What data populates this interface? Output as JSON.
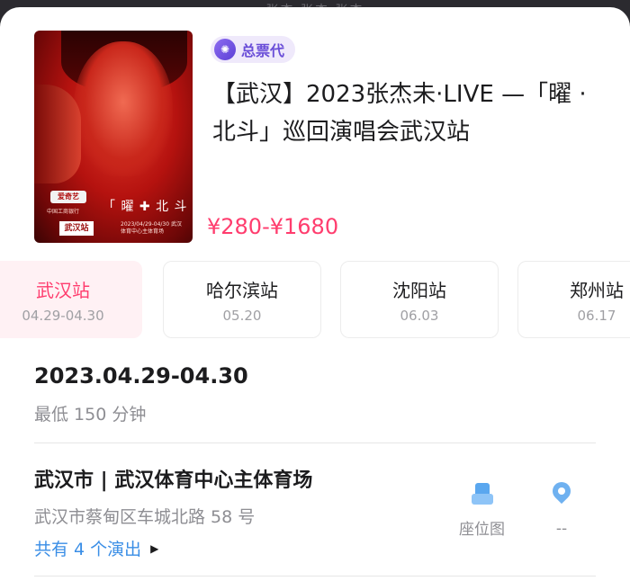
{
  "top_strip": {
    "text": "张杰 张杰 张杰"
  },
  "event": {
    "badge": "总票代",
    "title": "【武汉】2023张杰未·LIVE —「曜 · 北斗」巡回演唱会武汉站",
    "price": "¥280-¥1680",
    "poster": {
      "logo": "爱奇艺",
      "tagline": "中国工商银行",
      "title_text": "「 曜 ✚ 北 斗 」",
      "dates": "2023/04/29-04/30 武汉体育中心主体育场",
      "station_label": "武汉站"
    }
  },
  "stations": [
    {
      "name": "武汉站",
      "dates": "04.29-04.30",
      "active": true
    },
    {
      "name": "哈尔滨站",
      "dates": "05.20",
      "active": false
    },
    {
      "name": "沈阳站",
      "dates": "06.03",
      "active": false
    },
    {
      "name": "郑州站",
      "dates": "06.17",
      "active": false
    }
  ],
  "details": {
    "date_range": "2023.04.29-04.30",
    "duration": "最低 150 分钟",
    "venue": "武汉市 | 武汉体育中心主体育场",
    "address": "武汉市蔡甸区车城北路 58 号",
    "shows_link": "共有 4 个演出",
    "seat_map_label": "座位图",
    "distance_label": "--"
  },
  "colors": {
    "accent": "#ff3d6e",
    "link": "#3a8ee6",
    "badge_bg": "#efe9fb",
    "badge_text": "#6a4ed8",
    "active_tab_bg": "#fff1f4"
  },
  "icons": [
    "seat-map-icon",
    "location-pin-icon",
    "arrow-right-icon",
    "agency-badge-icon"
  ]
}
